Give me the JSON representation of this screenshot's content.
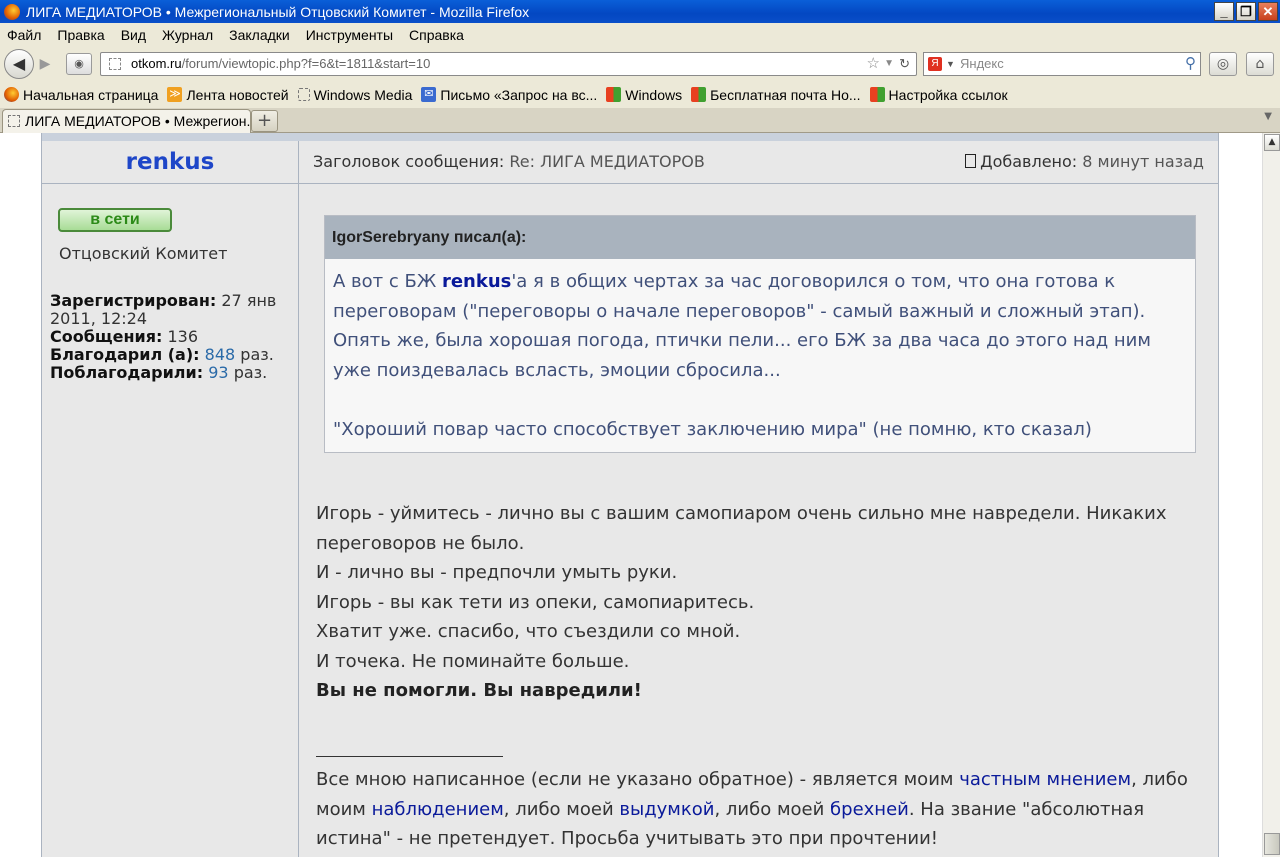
{
  "window": {
    "title": "ЛИГА МЕДИАТОРОВ • Межрегиональный Отцовский Комитет - Mozilla Firefox",
    "min_label": "_",
    "max_label": "❐",
    "close_label": "✕"
  },
  "menu": {
    "items": [
      "Файл",
      "Правка",
      "Вид",
      "Журнал",
      "Закладки",
      "Инструменты",
      "Справка"
    ]
  },
  "nav": {
    "url_domain": "otkom.ru",
    "url_path": "/forum/viewtopic.php?f=6&t=1811&start=10",
    "search_placeholder": "Яндекс"
  },
  "bookmarks": {
    "items": [
      {
        "label": "Начальная страница",
        "icon": "firefox-icon"
      },
      {
        "label": "Лента новостей",
        "icon": "rss-icon"
      },
      {
        "label": "Windows Media",
        "icon": "page-icon"
      },
      {
        "label": "Письмо «Запрос на вс...",
        "icon": "mail-icon"
      },
      {
        "label": "Windows",
        "icon": "windows-icon"
      },
      {
        "label": "Бесплатная почта Но...",
        "icon": "windows-icon"
      },
      {
        "label": "Настройка ссылок",
        "icon": "windows-icon"
      }
    ]
  },
  "tabs": {
    "active_label": "ЛИГА МЕДИАТОРОВ • Межрегион...",
    "new_tab_label": "+"
  },
  "post": {
    "author": "renkus",
    "subject_label": "Заголовок сообщения:",
    "subject_value": "Re: ЛИГА МЕДИАТОРОВ",
    "added_label": "Добавлено:",
    "added_value": "8 минут назад",
    "online_label": "в сети",
    "rank": "Отцовский Комитет",
    "registered_label": "Зарегистрирован:",
    "registered_value": "27 янв 2011, 12:24",
    "posts_label": "Сообщения:",
    "posts_value": "136",
    "thanked_label": "Благодарил (а):",
    "thanked_value": "848",
    "thanked_unit": "раз.",
    "thanked_by_label": "Поблагодарили:",
    "thanked_by_value": "93",
    "thanked_by_unit": "раз.",
    "quote_header": "IgorSerebryany писал(а):",
    "quote_pre": "А вот с БЖ ",
    "quote_user": "renkus",
    "quote_text": "'а я в общих чертах за час договорился о том, что она готова к переговорам (\"переговоры о начале переговоров\" - самый важный и сложный этап). Опять же, была хорошая погода, птички пели... его БЖ за два часа до этого над ним уже поиздевалась всласть, эмоции сбросила...",
    "quote_last": "\"Хороший повар часто способствует заключению мира\" (не помню, кто сказал)",
    "message_lines": [
      "Игорь - уймитесь - лично вы с вашим самопиаром очень сильно мне навредели. Никаких переговоров не было.",
      "И - лично вы - предпочли умыть руки.",
      "Игорь - вы как тети из опеки, самопиаритесь.",
      "Хватит уже. спасибо, что съездили со мной.",
      "И точека. Не поминайте больше."
    ],
    "message_bold": "Вы не помогли. Вы навредили!",
    "signature": {
      "p1": "Все мною написанное (если не указано обратное) - является моим ",
      "l1": "частным мнением",
      "p2": ", либо моим ",
      "l2": "наблюдением",
      "p3": ", либо моей ",
      "l3": "выдумкой",
      "p4": ", либо моей ",
      "l4": "брехней",
      "p5": ". На звание \"абсолютная истина\" - не претендует. Просьба учитывать это при прочтении!"
    }
  }
}
